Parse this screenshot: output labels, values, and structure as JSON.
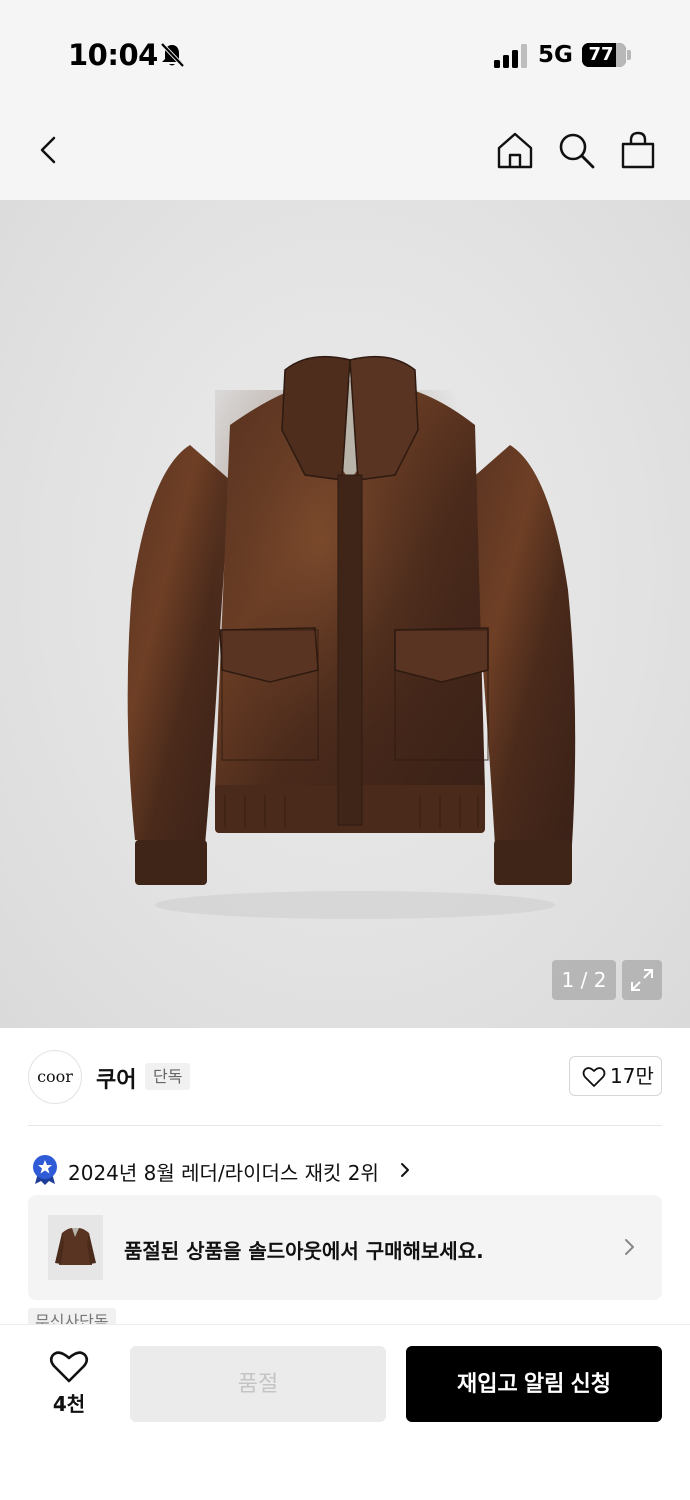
{
  "status_bar": {
    "time": "10:04",
    "network": "5G",
    "battery_level": "77",
    "battery_percent": 77
  },
  "nav": {
    "icons": [
      "back-icon",
      "home-icon",
      "search-icon",
      "cart-icon"
    ]
  },
  "product_image": {
    "pager": "1 / 2"
  },
  "brand": {
    "logo_text": "coor",
    "name": "쿠어",
    "badge": "단독",
    "like_count": "17만"
  },
  "ranking": {
    "text": "2024년 8월 레더/라이더스 재킷 2위"
  },
  "soldout_banner": {
    "text": "품절된 상품을 솔드아웃에서 구매해보세요."
  },
  "tag_partial": "무신사단독",
  "bottom_bar": {
    "wish_count": "4천",
    "soldout_label": "품절",
    "restock_label": "재입고 알림 신청"
  },
  "colors": {
    "accent_primary": "#000000",
    "rank_badge": "#2f5bd6",
    "disabled_button": "#ebebeb"
  }
}
